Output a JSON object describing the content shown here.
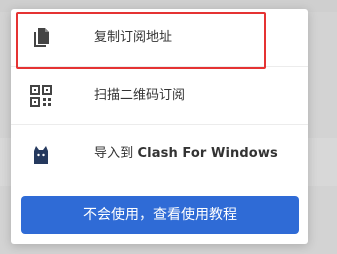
{
  "menu": {
    "items": [
      {
        "label": "复制订阅地址",
        "icon": "copy-icon"
      },
      {
        "label": "扫描二维码订阅",
        "icon": "qr-code-icon"
      },
      {
        "label_prefix": "导入到 ",
        "label_app": "Clash For Windows",
        "icon": "clash-cat-icon"
      }
    ],
    "help_button_label": "不会使用，查看使用教程"
  },
  "colors": {
    "button": "#2f6bd6",
    "highlight": "#e53333",
    "icon": "#444444",
    "clash_icon": "#25395e"
  }
}
